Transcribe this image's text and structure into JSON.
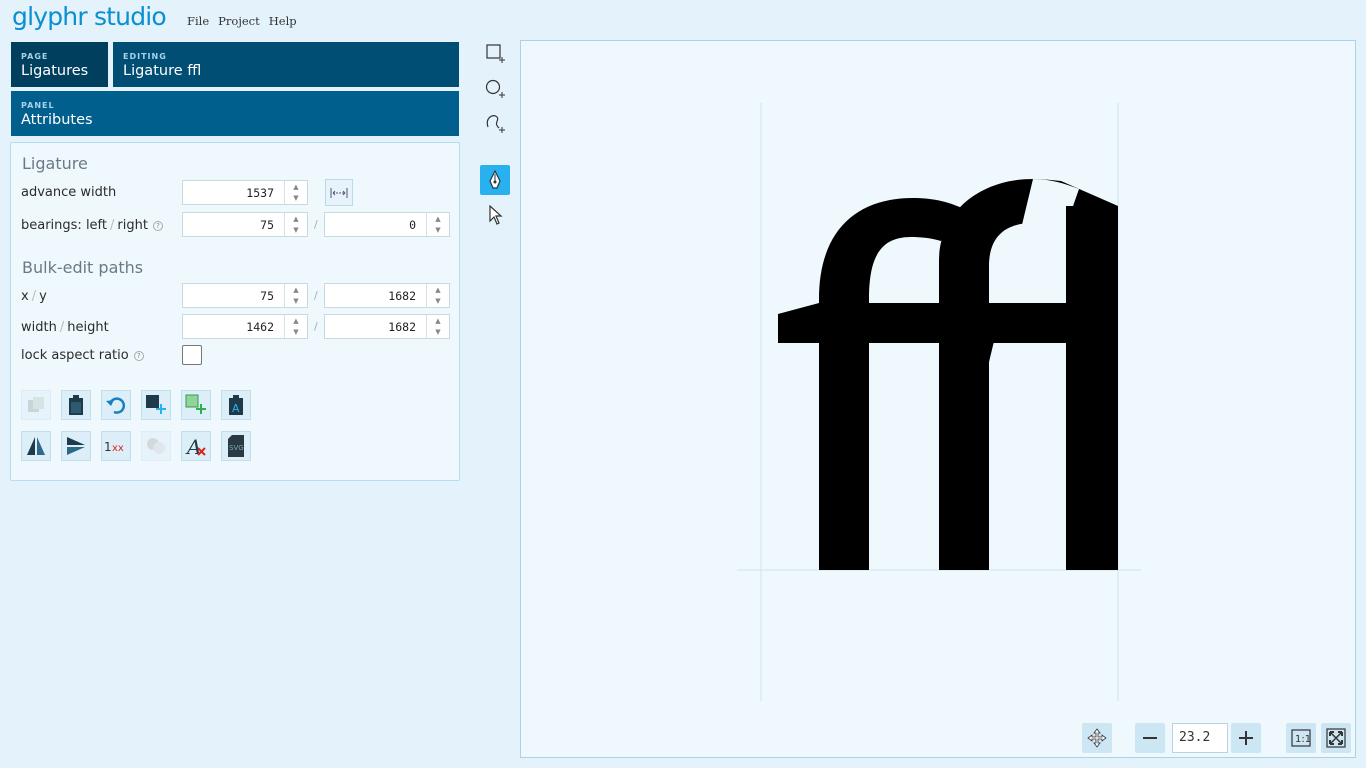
{
  "app": {
    "logo": "glyphr studio"
  },
  "menu": [
    "File",
    "Project",
    "Help"
  ],
  "nav": {
    "page_label": "PAGE",
    "page_value": "Ligatures",
    "editing_label": "EDITING",
    "editing_value": "Ligature ffl",
    "panel_label": "PANEL",
    "panel_value": "Attributes"
  },
  "ligature": {
    "title": "Ligature",
    "advance_width_label": "advance width",
    "advance_width": "1537",
    "bearings_label_a": "bearings: left",
    "bearings_label_b": "right",
    "bearing_left": "75",
    "bearing_right": "0"
  },
  "bulk": {
    "title": "Bulk-edit paths",
    "xy_label_a": "x",
    "xy_label_b": "y",
    "x": "75",
    "y": "1682",
    "wh_label_a": "width",
    "wh_label_b": "height",
    "width": "1462",
    "height": "1682",
    "lock_label": "lock aspect ratio",
    "lock_checked": false
  },
  "glyph": {
    "text": "ffl"
  },
  "zoom": {
    "value": "23.2"
  },
  "colors": {
    "accent": "#28b0ef",
    "nav_dark": "#003f5e",
    "panel_bg": "#eff8fd"
  },
  "icons": {
    "tools_row1": [
      "copy-icon",
      "paste-icon",
      "undo-icon",
      "add-path-icon",
      "add-component-icon",
      "glyph-link-icon"
    ],
    "tools_row2": [
      "flip-horizontal-icon",
      "flip-vertical-icon",
      "remove-kerning-icon",
      "combine-icon",
      "delete-glyph-icon",
      "export-svg-icon"
    ]
  }
}
